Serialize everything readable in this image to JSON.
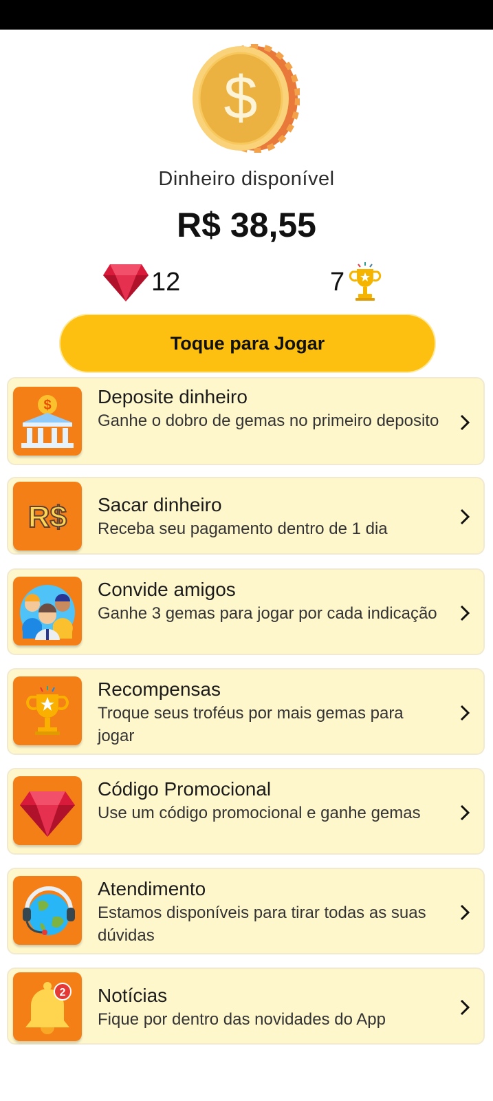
{
  "balance": {
    "label": "Dinheiro disponível",
    "value": "R$ 38,55"
  },
  "stats": {
    "gems": "12",
    "trophies": "7"
  },
  "play_button": {
    "label": "Toque para Jogar"
  },
  "menu": [
    {
      "title": "Deposite dinheiro",
      "subtitle": "Ganhe o dobro de gemas no primeiro deposito",
      "icon": "bank-icon"
    },
    {
      "title": "Sacar dinheiro",
      "subtitle": "Receba seu pagamento dentro de 1 dia",
      "icon": "real-currency-icon"
    },
    {
      "title": "Convide amigos",
      "subtitle": "Ganhe 3 gemas para jogar por cada indicação",
      "icon": "friends-icon"
    },
    {
      "title": "Recompensas",
      "subtitle": "Troque seus troféus por mais gemas para jogar",
      "icon": "trophy-icon"
    },
    {
      "title": "Código Promocional",
      "subtitle": "Use um código promocional e ganhe gemas",
      "icon": "gem-icon"
    },
    {
      "title": "Atendimento",
      "subtitle": "Estamos disponíveis para tirar todas as suas dúvidas",
      "icon": "support-globe-icon"
    },
    {
      "title": "Notícias",
      "subtitle": "Fique por dentro das novidades do App",
      "icon": "bell-icon",
      "badge": "2"
    }
  ],
  "colors": {
    "accent": "#FDC010",
    "card_bg": "#FFF7CC",
    "icon_bg": "#F57F17",
    "gem": "#D81B3A"
  }
}
